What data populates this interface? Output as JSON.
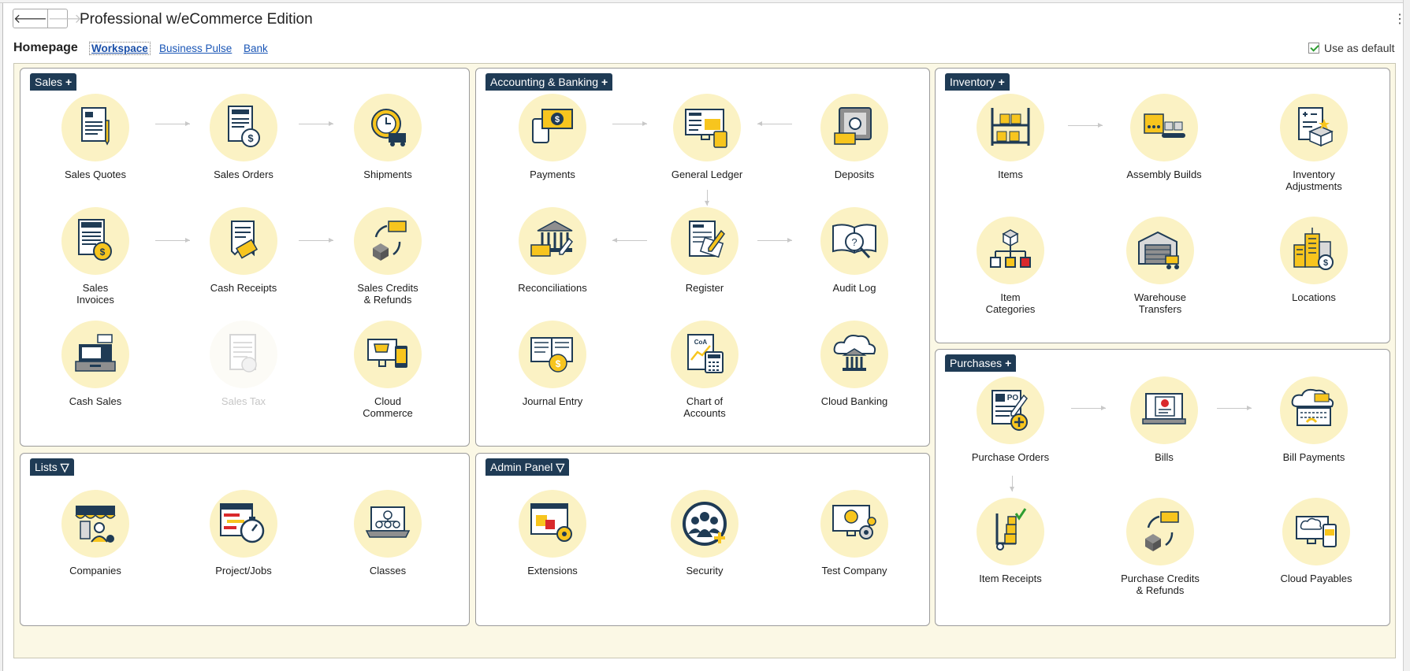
{
  "window": {
    "title": "Professional w/eCommerce Edition",
    "menu_icon": "kebab-icon"
  },
  "nav": {
    "back_icon": "arrow-left-icon",
    "forward_icon": "arrow-right-icon"
  },
  "homepage": {
    "label": "Homepage",
    "tabs": [
      {
        "label": "Workspace",
        "active": true
      },
      {
        "label": "Business Pulse",
        "active": false
      },
      {
        "label": "Bank",
        "active": false
      }
    ],
    "use_as_default": {
      "label": "Use as default",
      "checked": true
    }
  },
  "panels": {
    "sales": {
      "title": "Sales",
      "symbol": "+",
      "items": [
        {
          "label": "Sales Quotes",
          "icon": "sales-quotes-icon"
        },
        {
          "label": "Sales Orders",
          "icon": "sales-orders-icon"
        },
        {
          "label": "Shipments",
          "icon": "shipments-icon"
        },
        {
          "label": "Sales\nInvoices",
          "icon": "sales-invoices-icon"
        },
        {
          "label": "Cash Receipts",
          "icon": "cash-receipts-icon"
        },
        {
          "label": "Sales Credits\n& Refunds",
          "icon": "sales-credits-icon"
        },
        {
          "label": "Cash Sales",
          "icon": "cash-register-icon"
        },
        {
          "label": "Sales Tax",
          "icon": "sales-tax-icon",
          "disabled": true
        },
        {
          "label": "Cloud\nCommerce",
          "icon": "cloud-commerce-icon"
        }
      ]
    },
    "accounting": {
      "title": "Accounting & Banking",
      "symbol": "+",
      "items": [
        {
          "label": "Payments",
          "icon": "payments-icon"
        },
        {
          "label": "General Ledger",
          "icon": "general-ledger-icon"
        },
        {
          "label": "Deposits",
          "icon": "deposits-icon"
        },
        {
          "label": "Reconciliations",
          "icon": "bank-building-icon"
        },
        {
          "label": "Register",
          "icon": "register-icon"
        },
        {
          "label": "Audit Log",
          "icon": "audit-log-icon"
        },
        {
          "label": "Journal Entry",
          "icon": "journal-entry-icon"
        },
        {
          "label": "Chart of\nAccounts",
          "icon": "chart-of-accounts-icon"
        },
        {
          "label": "Cloud Banking",
          "icon": "cloud-banking-icon"
        }
      ]
    },
    "inventory": {
      "title": "Inventory",
      "symbol": "+",
      "items": [
        {
          "label": "Items",
          "icon": "items-icon"
        },
        {
          "label": "Assembly Builds",
          "icon": "assembly-builds-icon"
        },
        {
          "label": "Inventory\nAdjustments",
          "icon": "inventory-adjustments-icon"
        },
        {
          "label": "Item\nCategories",
          "icon": "item-categories-icon"
        },
        {
          "label": "Warehouse\nTransfers",
          "icon": "warehouse-icon"
        },
        {
          "label": "Locations",
          "icon": "locations-icon"
        }
      ]
    },
    "lists": {
      "title": "Lists",
      "symbol": "▽",
      "items": [
        {
          "label": "Companies",
          "icon": "companies-icon"
        },
        {
          "label": "Project/Jobs",
          "icon": "project-jobs-icon"
        },
        {
          "label": "Classes",
          "icon": "classes-icon"
        }
      ]
    },
    "admin": {
      "title": "Admin Panel",
      "symbol": "▽",
      "items": [
        {
          "label": "Extensions",
          "icon": "extensions-icon"
        },
        {
          "label": "Security",
          "icon": "security-icon"
        },
        {
          "label": "Test Company",
          "icon": "test-company-icon"
        }
      ]
    },
    "purchases": {
      "title": "Purchases",
      "symbol": "+",
      "items": [
        {
          "label": "Purchase Orders",
          "icon": "purchase-orders-icon"
        },
        {
          "label": "Bills",
          "icon": "bills-icon"
        },
        {
          "label": "Bill Payments",
          "icon": "bill-payments-icon"
        },
        {
          "label": "Item Receipts",
          "icon": "item-receipts-icon"
        },
        {
          "label": "Purchase Credits\n& Refunds",
          "icon": "purchase-credits-icon"
        },
        {
          "label": "Cloud Payables",
          "icon": "cloud-payables-icon"
        }
      ]
    }
  },
  "colors": {
    "accent": "#f7c51e",
    "circle": "#fbf2c4",
    "header": "#1f3b55",
    "workspace": "#fbf8e5",
    "link": "#1a56b6"
  }
}
